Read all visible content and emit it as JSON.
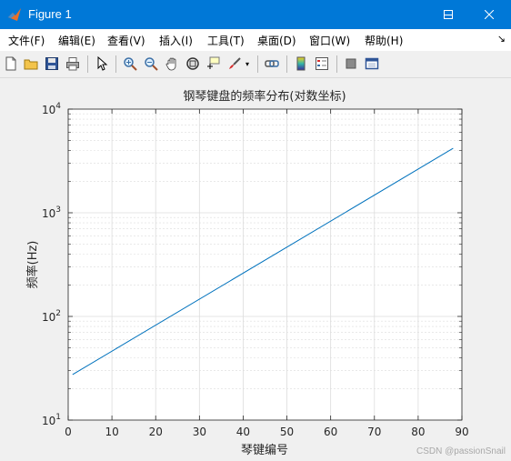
{
  "window": {
    "title": "Figure 1"
  },
  "menu": {
    "items": [
      "文件(F)",
      "编辑(E)",
      "查看(V)",
      "插入(I)",
      "工具(T)",
      "桌面(D)",
      "窗口(W)",
      "帮助(H)"
    ],
    "overflow_icon": "arrow-icon"
  },
  "toolbar": {
    "icons": [
      "new-figure-icon",
      "open-file-icon",
      "save-icon",
      "print-icon",
      "pointer-icon",
      "zoom-in-icon",
      "zoom-out-icon",
      "pan-icon",
      "rotate-3d-icon",
      "data-cursor-icon",
      "brush-icon",
      "link-plot-icon",
      "colorbar-icon",
      "legend-icon",
      "hide-plot-tools-icon",
      "show-plot-tools-icon"
    ]
  },
  "colors": {
    "titlebar": "#0078d7",
    "line": "#0072bd",
    "grid": "#dcdcdc"
  },
  "chart_data": {
    "type": "line",
    "title": "钢琴键盘的频率分布(对数坐标)",
    "xlabel": "琴键编号",
    "ylabel": "频率(Hz)",
    "xlim": [
      0,
      90
    ],
    "ylim": [
      10,
      10000
    ],
    "yscale": "log",
    "grid": true,
    "xticks": [
      "0",
      "10",
      "20",
      "30",
      "40",
      "50",
      "60",
      "70",
      "80",
      "90"
    ],
    "yticks": [
      {
        "base": "10",
        "exp": "1"
      },
      {
        "base": "10",
        "exp": "2"
      },
      {
        "base": "10",
        "exp": "3"
      },
      {
        "base": "10",
        "exp": "4"
      }
    ],
    "series": [
      {
        "x": [
          1,
          88
        ],
        "y": [
          27.5,
          4186.01
        ]
      }
    ]
  },
  "watermark": "CSDN @passionSnail"
}
